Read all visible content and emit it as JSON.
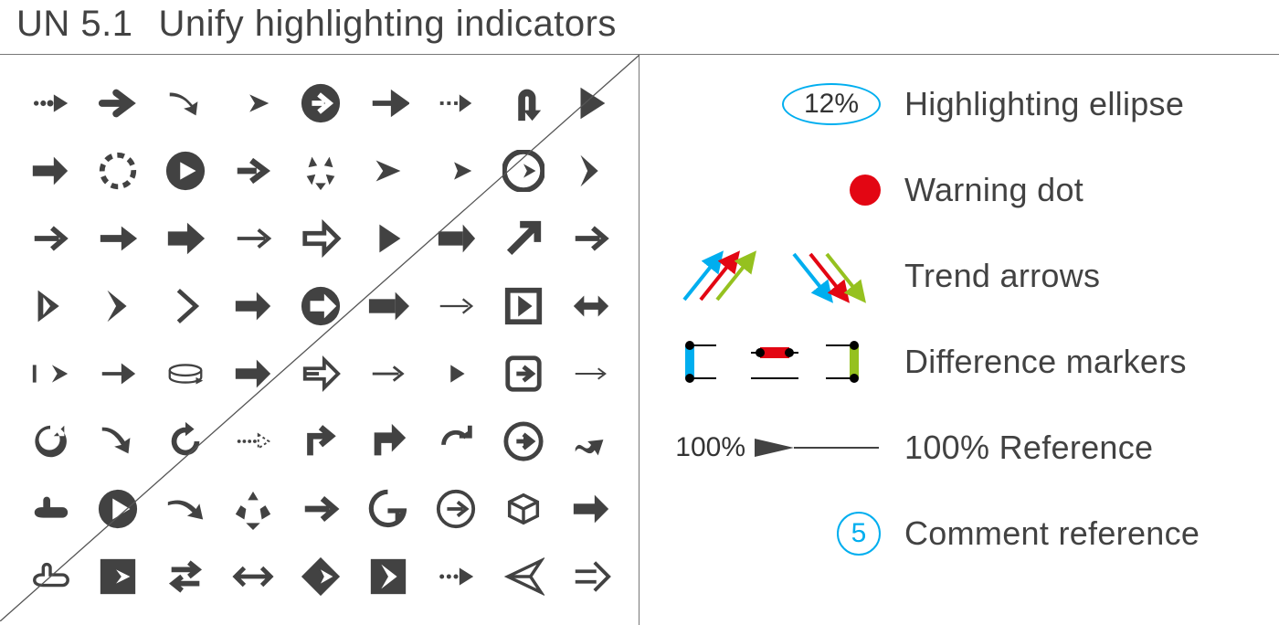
{
  "title": {
    "code": "UN 5.1",
    "text": "Unify highlighting indicators"
  },
  "colors": {
    "blue": "#00AEEF",
    "red": "#E30613",
    "green": "#95C11F",
    "icon": "#424242"
  },
  "legend": {
    "ellipse": {
      "value": "12%",
      "label": "Highlighting ellipse"
    },
    "warning_dot": {
      "label": "Warning dot"
    },
    "trend_arrows": {
      "label": "Trend arrows"
    },
    "diff_markers": {
      "label": "Difference markers"
    },
    "reference": {
      "value": "100%",
      "label": "100% Reference"
    },
    "comment_ref": {
      "value": "5",
      "label": "Comment reference"
    }
  },
  "icon_grid": {
    "rows": 8,
    "cols": 9,
    "description": "Assorted arrow icon variants"
  }
}
